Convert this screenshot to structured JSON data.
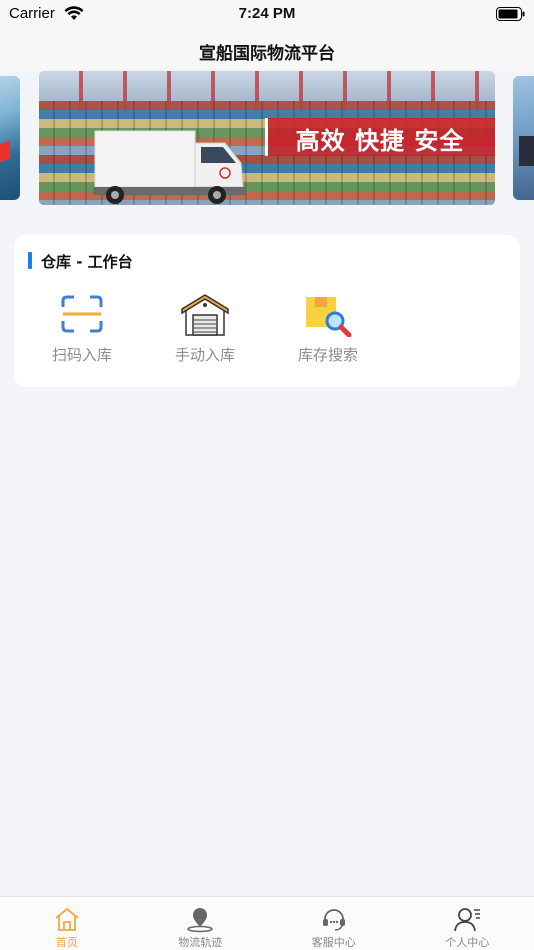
{
  "status_bar": {
    "carrier": "Carrier",
    "time": "7:24 PM"
  },
  "navbar": {
    "title": "宣船国际物流平台"
  },
  "banner": {
    "slogan": "高效  快捷  安全"
  },
  "workbench": {
    "title": "仓库 - 工作台",
    "tools": [
      {
        "label": "扫码入库",
        "icon": "scan-icon"
      },
      {
        "label": "手动入库",
        "icon": "warehouse-icon"
      },
      {
        "label": "库存搜索",
        "icon": "inventory-search-icon"
      }
    ]
  },
  "tabbar": {
    "tabs": [
      {
        "label": "首页",
        "icon": "home-icon",
        "active": true
      },
      {
        "label": "物流轨迹",
        "icon": "location-icon",
        "active": false
      },
      {
        "label": "客服中心",
        "icon": "headset-icon",
        "active": false
      },
      {
        "label": "个人中心",
        "icon": "user-icon",
        "active": false
      }
    ]
  },
  "colors": {
    "accent": "#1e7cf5",
    "tab_active": "#f3a73b",
    "banner_red": "#c81e28"
  }
}
